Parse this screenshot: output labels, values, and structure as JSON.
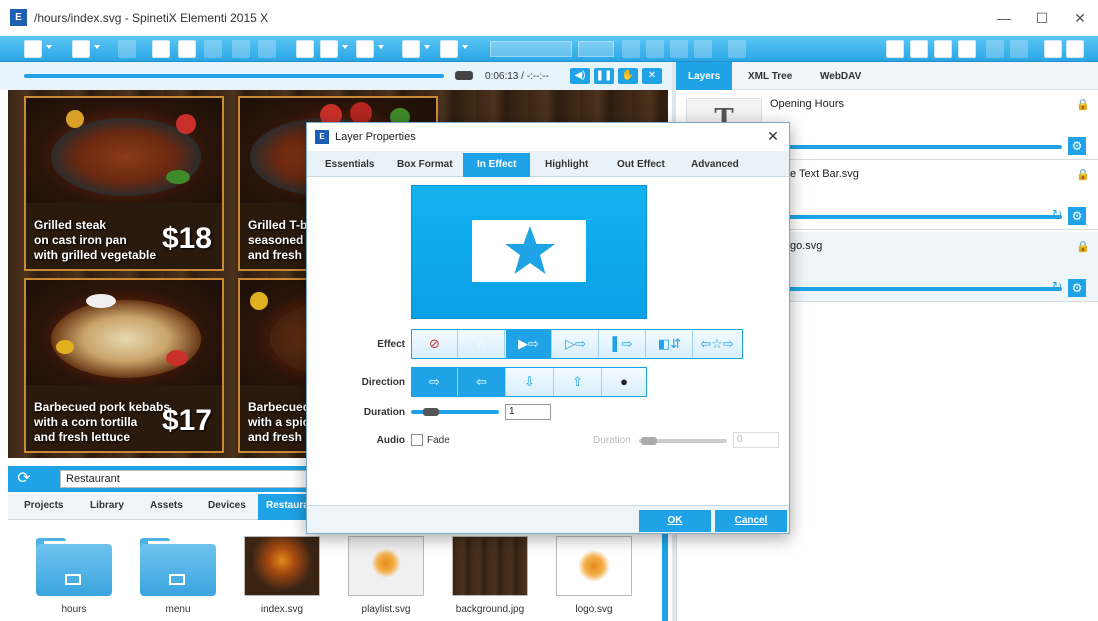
{
  "window": {
    "title": "/hours/index.svg - SpinetiX Elementi 2015 X",
    "logo": "E",
    "controls": {
      "minimize": "—",
      "maximize": "☐",
      "close": "✕"
    }
  },
  "player": {
    "time": "0:06:13 / -:--:--",
    "buttons": {
      "volume": "◀)",
      "pause": "❚❚",
      "hand": "✋",
      "close": "✕"
    }
  },
  "preview": {
    "items": [
      {
        "text": "Grilled steak\non cast iron pan\nwith grilled vegetable",
        "price": "$18"
      },
      {
        "text": "Grilled T-bo\nseasoned t\nand fresh h",
        "price": ""
      },
      {
        "text": "Barbecued pork kebabs\nwith a corn tortilla\nand fresh lettuce",
        "price": "$17"
      },
      {
        "text": "Barbecued\nwith a spic\nand fresh l",
        "price": ""
      }
    ]
  },
  "search": {
    "value": "Restaurant",
    "refresh_icon": "⟳"
  },
  "bottom_tabs": [
    "Projects",
    "Library",
    "Assets",
    "Devices",
    "Restaurant"
  ],
  "files": [
    {
      "name": "hours",
      "type": "folder"
    },
    {
      "name": "menu",
      "type": "folder"
    },
    {
      "name": "index.svg",
      "type": "image"
    },
    {
      "name": "playlist.svg",
      "type": "image"
    },
    {
      "name": "background.jpg",
      "type": "image"
    },
    {
      "name": "logo.svg",
      "type": "image"
    }
  ],
  "right_tabs": [
    "Layers",
    "XML Tree",
    "WebDAV"
  ],
  "layers": [
    {
      "name": "Opening Hours",
      "thumb": "T"
    },
    {
      "name": "e Text Bar.svg"
    },
    {
      "name": "go.svg"
    }
  ],
  "layer_icons": {
    "lock": "🔒",
    "gear": "⚙",
    "loop": "↻"
  },
  "dialog": {
    "title": "Layer Properties",
    "logo": "E",
    "close": "✕",
    "tabs": [
      "Essentials",
      "Box Format",
      "In Effect",
      "Highlight",
      "Out Effect",
      "Advanced"
    ],
    "active_tab": "In Effect",
    "effect_label": "Effect",
    "effect_options": [
      "⊘",
      "☆",
      "▶⇨",
      "▷⇨",
      "▌⇨",
      "◧⇵",
      "⇦☆⇨"
    ],
    "direction_label": "Direction",
    "direction_options": [
      "⇨",
      "⇦",
      "⇩",
      "⇧",
      "●"
    ],
    "duration_label": "Duration",
    "duration_value": "1",
    "audio_label": "Audio",
    "fade_label": "Fade",
    "secondary_duration_label": "Duration",
    "secondary_duration_value": "0",
    "ok_label": "OK",
    "cancel_label": "Cancel"
  },
  "colors": {
    "accent": "#1fa3e6",
    "preview_bg": "#3a2515",
    "price_border": "#c98a33"
  }
}
